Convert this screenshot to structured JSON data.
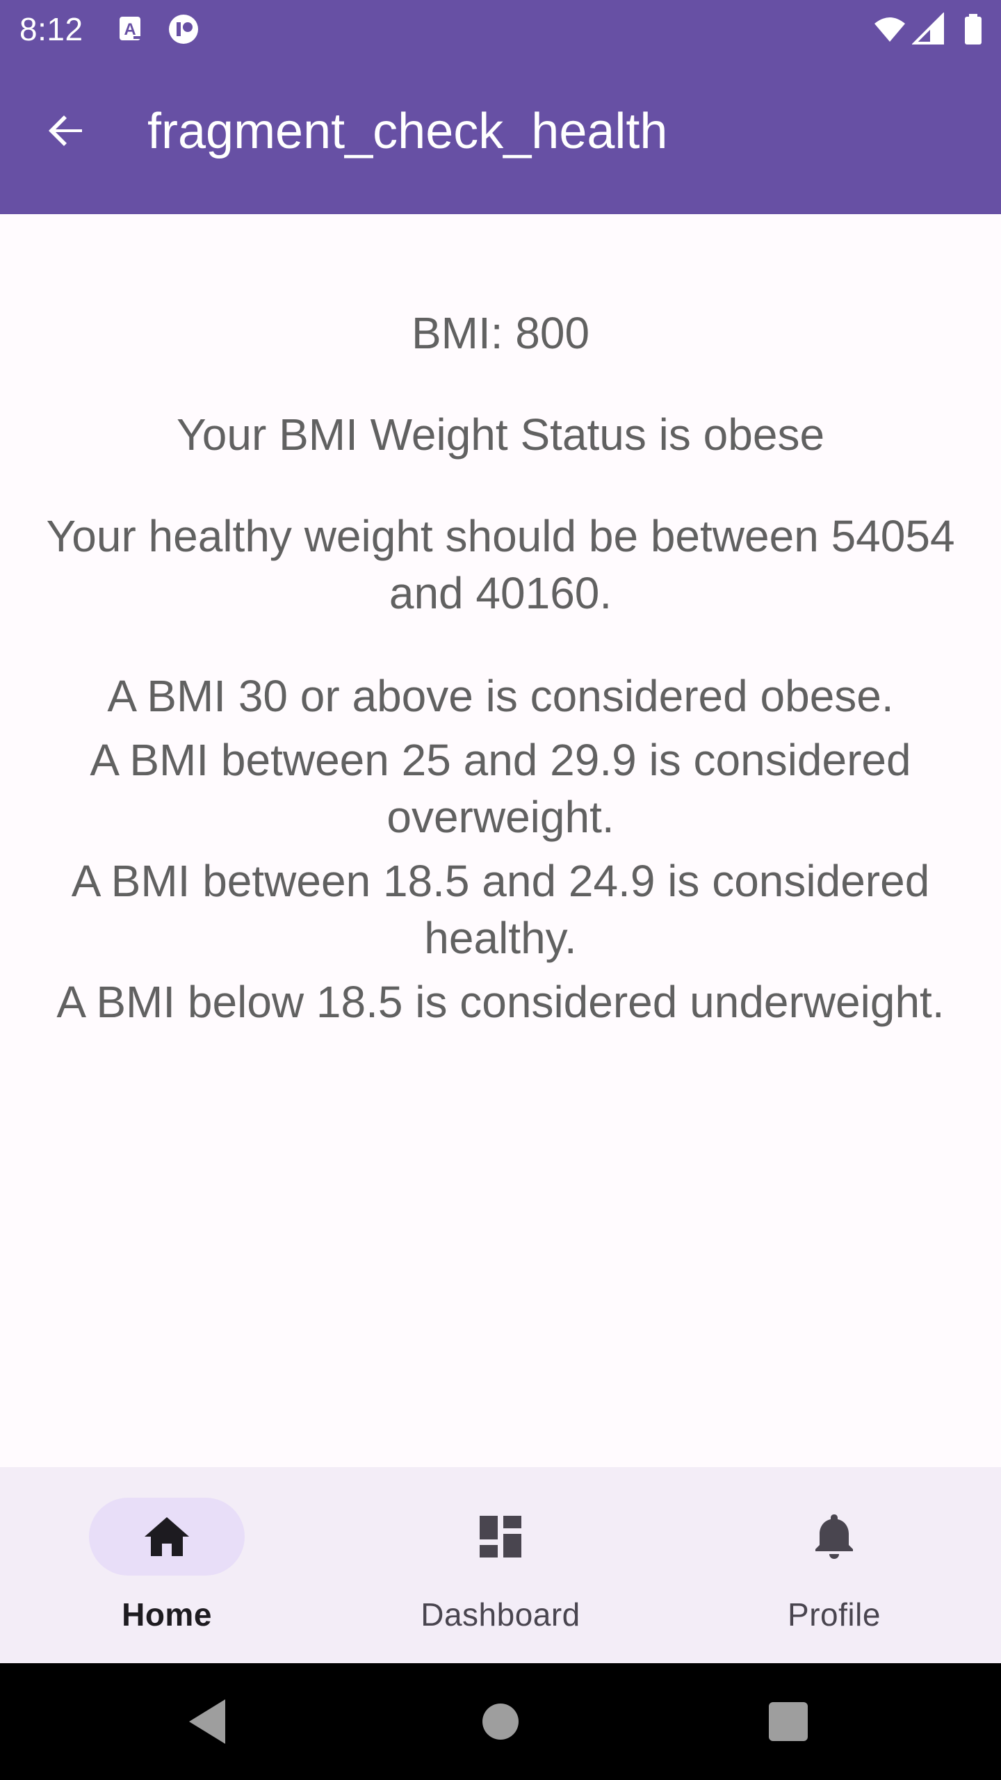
{
  "status_bar": {
    "time": "8:12",
    "left_icons": [
      "a11y-notification-icon",
      "app-notification-icon"
    ],
    "right_icons": [
      "wifi-icon",
      "signal-icon",
      "battery-icon"
    ]
  },
  "app_bar": {
    "title": "fragment_check_health",
    "back_icon": "arrow-back-icon",
    "color": "#6750A4"
  },
  "content": {
    "bmi_value": "BMI: 800",
    "weight_status": "Your BMI Weight Status is obese",
    "healthy_weight_line1": "Your healthy weight should be between 54054",
    "healthy_weight_line2": "and 40160.",
    "ranges": {
      "obese": "A BMI 30 or above is considered obese.",
      "overweight_line1": "A BMI between 25 and 29.9 is considered",
      "overweight_line2": "overweight.",
      "healthy_line1": "A BMI between 18.5 and 24.9 is considered",
      "healthy_line2": "healthy.",
      "underweight": "A BMI below 18.5 is considered underweight."
    }
  },
  "bottom_nav": {
    "items": [
      {
        "label": "Home",
        "icon": "home-icon",
        "selected": true
      },
      {
        "label": "Dashboard",
        "icon": "dashboard-icon",
        "selected": false
      },
      {
        "label": "Profile",
        "icon": "bell-icon",
        "selected": false
      }
    ]
  },
  "system_nav": {
    "buttons": [
      "back-triangle-icon",
      "home-circle-icon",
      "recents-square-icon"
    ]
  }
}
